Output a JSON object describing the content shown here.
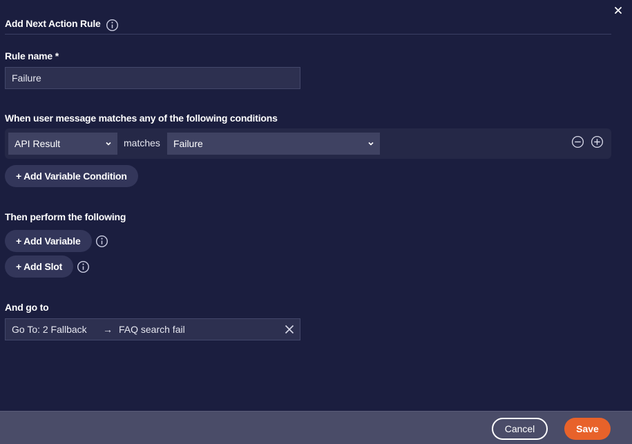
{
  "dialog": {
    "title": "Add Next Action Rule",
    "close_icon": "close-icon",
    "title_info_icon": "info-icon"
  },
  "rule_name": {
    "label": "Rule name *",
    "value": "Failure"
  },
  "conditions": {
    "label": "When user message matches any of the following conditions",
    "rows": [
      {
        "variable": "API Result",
        "operator": "matches",
        "value": "Failure"
      }
    ],
    "remove_icon": "minus-circle-icon",
    "add_icon": "plus-circle-icon",
    "add_condition_label": "+ Add Variable Condition"
  },
  "actions": {
    "label": "Then perform the following",
    "add_variable_label": "+ Add Variable",
    "add_slot_label": "+ Add Slot"
  },
  "goto": {
    "label": "And go to",
    "target": "Go To: 2 Fallback",
    "arrow": "→",
    "node": "FAQ search fail"
  },
  "footer": {
    "cancel_label": "Cancel",
    "save_label": "Save"
  },
  "colors": {
    "background": "#1b1e3f",
    "accent": "#e8622a",
    "footer": "#4a4c68"
  }
}
